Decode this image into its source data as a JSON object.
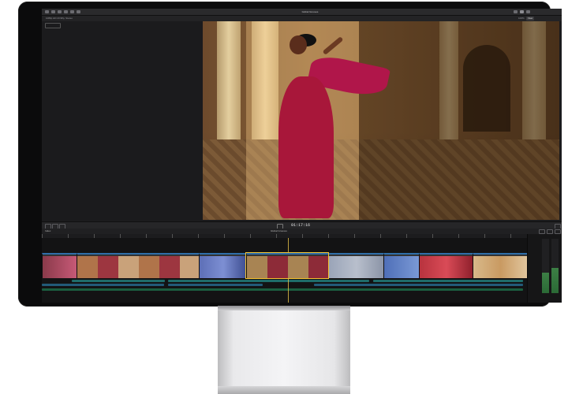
{
  "window": {
    "title": "Global Grooves",
    "info": "1080p HD 23.98p, Stereo"
  },
  "viewer": {
    "zoom": "100%",
    "view_label": "View"
  },
  "timeline": {
    "index_label": "Index",
    "project": "Global Grooves",
    "timecode": "01:17:16"
  },
  "icons": [
    "play-icon",
    "skimmer-icon",
    "snap-icon",
    "audio-meter-icon"
  ],
  "colors": {
    "clip_header": "#2f6ea8",
    "selection": "#f2c230",
    "audio_lane": "#1f6c6a",
    "meter": "#3c7f45"
  }
}
